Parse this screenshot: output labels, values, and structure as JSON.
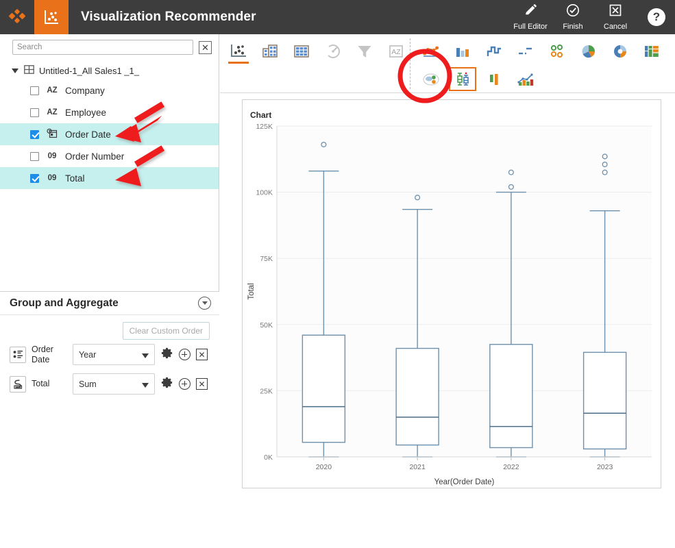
{
  "titlebar": {
    "app_title": "Visualization Recommender",
    "logo_icon": "app-logo-icon",
    "mode_icon": "visualization-recommender-icon",
    "actions": [
      {
        "label": "Full Editor",
        "icon": "pencil-icon",
        "name": "full-editor-button"
      },
      {
        "label": "Finish",
        "icon": "check-circle-icon",
        "name": "finish-button"
      },
      {
        "label": "Cancel",
        "icon": "x-square-icon",
        "name": "cancel-button"
      }
    ],
    "help_label": "?",
    "background": "#3d3d3d",
    "accent": "#e8711a"
  },
  "sidebar": {
    "search": {
      "placeholder": "Search",
      "value": "",
      "clear_label": "✕"
    },
    "tree": {
      "root_label": "Untitled-1_All Sales1 _1_",
      "root_icon": "table-icon",
      "items": [
        {
          "label": "Company",
          "type": "AZ",
          "checked": false
        },
        {
          "label": "Employee",
          "type": "AZ",
          "checked": false
        },
        {
          "label": "Order Date",
          "type": "date",
          "checked": true
        },
        {
          "label": "Order Number",
          "type": "09",
          "checked": false
        },
        {
          "label": "Total",
          "type": "09",
          "checked": true
        }
      ]
    },
    "group_aggregate": {
      "title": "Group and Aggregate",
      "clear_button": "Clear Custom Order",
      "rows": [
        {
          "field": "Order Date",
          "icon": "group-field-icon",
          "value": "Year",
          "name": "order-date"
        },
        {
          "field": "Total",
          "icon": "aggregate-field-icon",
          "value": "Sum",
          "name": "total"
        }
      ],
      "row_actions": {
        "settings": "gear-icon",
        "add": "plus-circle-icon",
        "remove": "x-square-icon"
      }
    }
  },
  "chart_toolbar": {
    "categories": [
      {
        "name": "scatter-recommendation-tab",
        "icon": "scatter-plot-icon",
        "active": true
      },
      {
        "name": "table-recommendation-tab",
        "icon": "table-blocks-icon",
        "active": false
      },
      {
        "name": "grid-recommendation-tab",
        "icon": "grid-icon",
        "active": false
      },
      {
        "name": "gauge-recommendation-tab",
        "icon": "gauge-icon",
        "active": false
      },
      {
        "name": "filter-recommendation-tab",
        "icon": "funnel-icon",
        "active": false
      },
      {
        "name": "text-recommendation-tab",
        "icon": "az-text-icon",
        "active": false
      }
    ],
    "chart_types": [
      {
        "name": "bubble-chart-type",
        "icon": "bubble-chart-icon",
        "selected": false
      },
      {
        "name": "bar-chart-type",
        "icon": "bar-chart-icon",
        "selected": false
      },
      {
        "name": "step-chart-type",
        "icon": "step-line-chart-icon",
        "selected": false
      },
      {
        "name": "gantt-chart-type",
        "icon": "gantt-chart-icon",
        "selected": false
      },
      {
        "name": "circle-pack-type",
        "icon": "circles-grid-icon",
        "selected": false
      },
      {
        "name": "pie-3d-chart-type",
        "icon": "pie-3d-chart-icon",
        "selected": false
      },
      {
        "name": "donut-chart-type",
        "icon": "donut-chart-icon",
        "selected": false
      },
      {
        "name": "treemap-chart-type",
        "icon": "treemap-icon",
        "selected": false
      },
      {
        "name": "cluster-chart-type",
        "icon": "cluster-bubble-icon",
        "selected": false
      },
      {
        "name": "boxplot-chart-type",
        "icon": "box-plot-icon",
        "selected": true
      },
      {
        "name": "column-chart-type",
        "icon": "column-chart-icon",
        "selected": false
      },
      {
        "name": "combo-chart-type",
        "icon": "combo-chart-icon",
        "selected": false
      }
    ],
    "highlight_color": "#e8711a",
    "annotation_color": "#e8121b"
  },
  "chart_panel": {
    "label": "Chart"
  },
  "chart_data": {
    "type": "boxplot",
    "title": "Chart",
    "xlabel": "Year(Order Date)",
    "ylabel": "Total",
    "categories": [
      "2020",
      "2021",
      "2022",
      "2023"
    ],
    "ylim": [
      0,
      125000
    ],
    "yticks": [
      0,
      25000,
      50000,
      75000,
      100000,
      125000
    ],
    "ytick_labels": [
      "0K",
      "25K",
      "50K",
      "75K",
      "100K",
      "125K"
    ],
    "grid": true,
    "legend": "none",
    "series_color": "#6e90ab",
    "boxes": [
      {
        "category": "2020",
        "whisker_low": 0,
        "q1": 5500,
        "median": 19000,
        "q3": 46000,
        "whisker_high": 108000,
        "outliers": [
          118000
        ]
      },
      {
        "category": "2021",
        "whisker_low": 0,
        "q1": 4500,
        "median": 15000,
        "q3": 41000,
        "whisker_high": 93500,
        "outliers": [
          98000
        ]
      },
      {
        "category": "2022",
        "whisker_low": 0,
        "q1": 3500,
        "median": 11500,
        "q3": 42500,
        "whisker_high": 100000,
        "outliers": [
          102000,
          107500
        ]
      },
      {
        "category": "2023",
        "whisker_low": 0,
        "q1": 3000,
        "median": 16500,
        "q3": 39500,
        "whisker_high": 93000,
        "outliers": [
          107500,
          110500,
          113500
        ]
      }
    ]
  },
  "annotations": {
    "arrows": [
      {
        "name": "arrow-to-order-date",
        "target": "Order Date"
      },
      {
        "name": "arrow-to-total",
        "target": "Total"
      }
    ],
    "circle": {
      "name": "boxplot-icon-highlight-circle",
      "target": "box-plot-icon"
    }
  }
}
